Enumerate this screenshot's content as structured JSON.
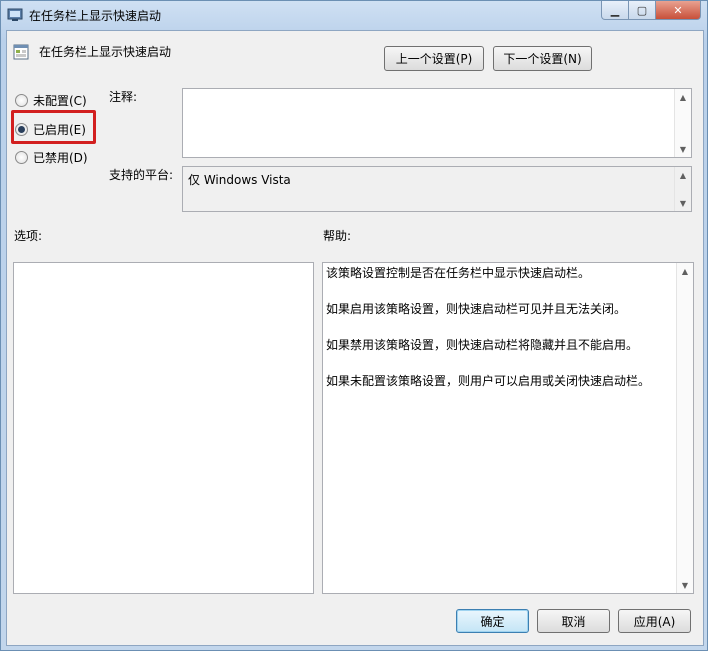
{
  "window": {
    "title": "在任务栏上显示快速启动",
    "controls": {
      "minimize": "▁",
      "maximize": "▢",
      "close": "✕"
    }
  },
  "policy": {
    "title": "在任务栏上显示快速启动",
    "prev_button": "上一个设置(P)",
    "next_button": "下一个设置(N)"
  },
  "state": {
    "options": [
      {
        "label": "未配置(C)",
        "selected": false
      },
      {
        "label": "已启用(E)",
        "selected": true
      },
      {
        "label": "已禁用(D)",
        "selected": false
      }
    ]
  },
  "comment": {
    "label": "注释:",
    "value": ""
  },
  "platform": {
    "label": "支持的平台:",
    "value": "仅 Windows Vista"
  },
  "options_panel": {
    "label": "选项:"
  },
  "help": {
    "label": "帮助:",
    "paragraphs": [
      "该策略设置控制是否在任务栏中显示快速启动栏。",
      "如果启用该策略设置，则快速启动栏可见并且无法关闭。",
      "如果禁用该策略设置，则快速启动栏将隐藏并且不能启用。",
      "如果未配置该策略设置，则用户可以启用或关闭快速启动栏。"
    ]
  },
  "footer": {
    "ok": "确定",
    "cancel": "取消",
    "apply": "应用(A)"
  },
  "colors": {
    "highlight": "#d21f1f",
    "client_bg": "#f0f0f0"
  }
}
